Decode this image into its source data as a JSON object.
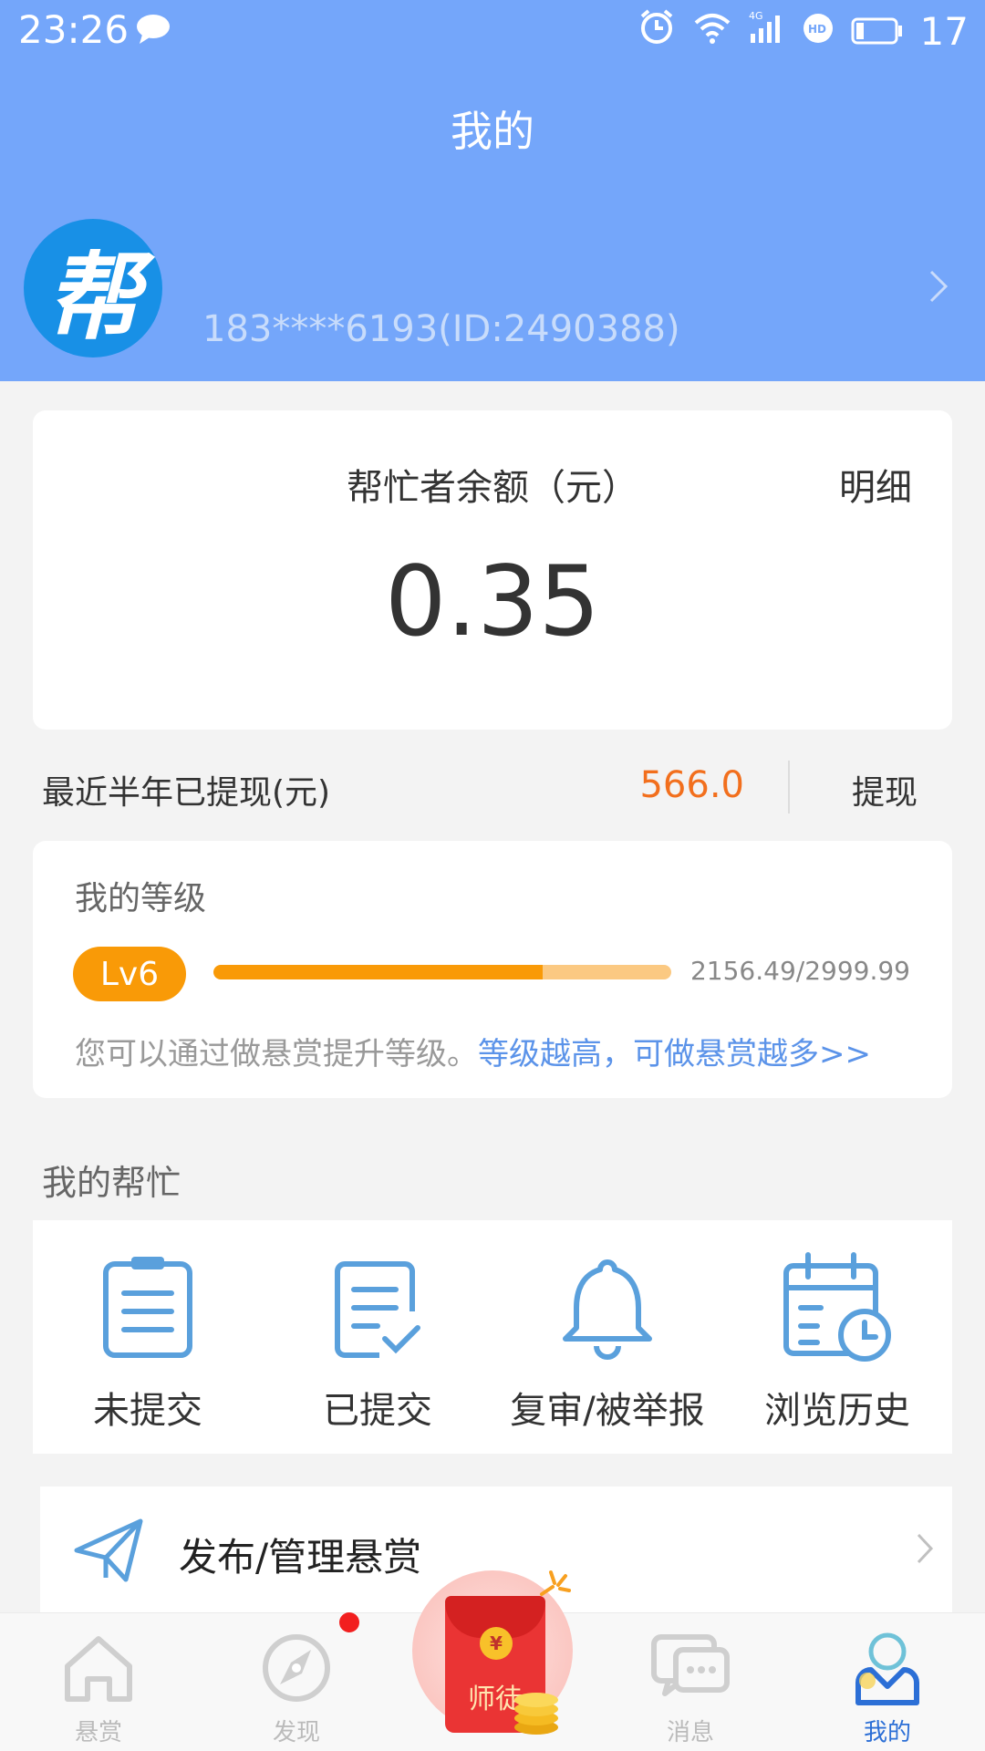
{
  "status_bar": {
    "time": "23:26",
    "battery": "17"
  },
  "page_title": "我的",
  "profile": {
    "avatar_text": "帮",
    "user_id": "183****6193(ID:2490388)"
  },
  "balance": {
    "label": "帮忙者余额（元）",
    "detail_link": "明细",
    "value": "0.35"
  },
  "withdraw": {
    "label": "最近半年已提现(元)",
    "amount": "566.0",
    "button": "提现"
  },
  "level": {
    "title": "我的等级",
    "badge": "Lv6",
    "points": "2156.49/2999.99",
    "progress": 0.7188,
    "tip": "您可以通过做悬赏提升等级。",
    "tip_link": "等级越高，可做悬赏越多>>"
  },
  "my_help": {
    "title": "我的帮忙",
    "items": [
      {
        "label": "未提交",
        "icon": "clipboard-list-icon"
      },
      {
        "label": "已提交",
        "icon": "document-check-icon"
      },
      {
        "label": "复审/被举报",
        "icon": "bell-icon"
      },
      {
        "label": "浏览历史",
        "icon": "calendar-clock-icon"
      }
    ]
  },
  "publish": {
    "label": "发布/管理悬赏",
    "icon": "paper-plane-icon"
  },
  "tabbar": {
    "tabs": [
      {
        "label": "悬赏",
        "icon": "home-icon"
      },
      {
        "label": "发现",
        "icon": "compass-icon"
      },
      {
        "label": "师徒",
        "icon": "red-envelope-icon"
      },
      {
        "label": "消息",
        "icon": "chat-icon"
      },
      {
        "label": "我的",
        "icon": "user-icon"
      }
    ],
    "active": "我的"
  },
  "colors": {
    "header": "#74a6fa",
    "accent_orange": "#f99a07",
    "withdraw_orange": "#f26f1d",
    "link_blue": "#5b93e9",
    "icon_blue": "#5aa0dc"
  }
}
